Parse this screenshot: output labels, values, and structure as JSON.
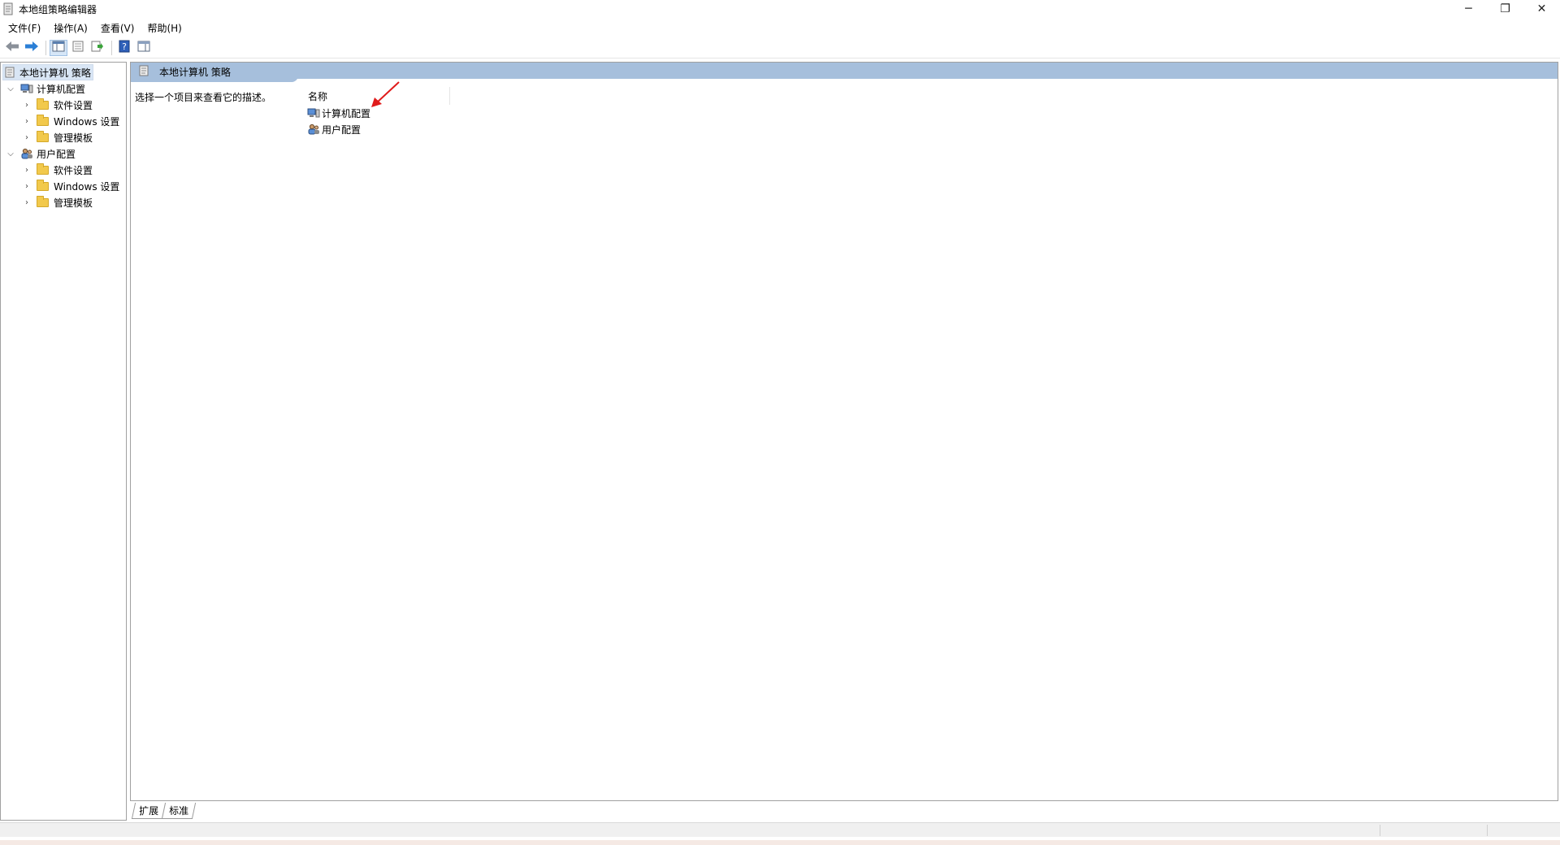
{
  "window": {
    "title": "本地组策略编辑器",
    "controls": {
      "minimize": "─",
      "restore": "❐",
      "close": "✕"
    }
  },
  "menubar": {
    "items": [
      "文件(F)",
      "操作(A)",
      "查看(V)",
      "帮助(H)"
    ]
  },
  "toolbar": {
    "buttons": [
      "back-icon",
      "forward-icon",
      "show-hide-tree-icon",
      "properties-icon",
      "export-list-icon",
      "help-icon",
      "show-hide-action-pane-icon"
    ]
  },
  "tree": {
    "root": "本地计算机 策略",
    "nodes": [
      {
        "label": "计算机配置",
        "expanded": true,
        "children": [
          "软件设置",
          "Windows 设置",
          "管理模板"
        ]
      },
      {
        "label": "用户配置",
        "expanded": true,
        "children": [
          "软件设置",
          "Windows 设置",
          "管理模板"
        ]
      }
    ]
  },
  "content": {
    "header_title": "本地计算机 策略",
    "description": "选择一个项目来查看它的描述。",
    "column_name": "名称",
    "items": [
      "计算机配置",
      "用户配置"
    ]
  },
  "tabs": [
    "扩展",
    "标准"
  ],
  "colors": {
    "header_bar": "#a6bfdc",
    "selected_root": "#d9e6f5",
    "folder": "#f2c94c",
    "annotation_arrow": "#e01b1b"
  }
}
